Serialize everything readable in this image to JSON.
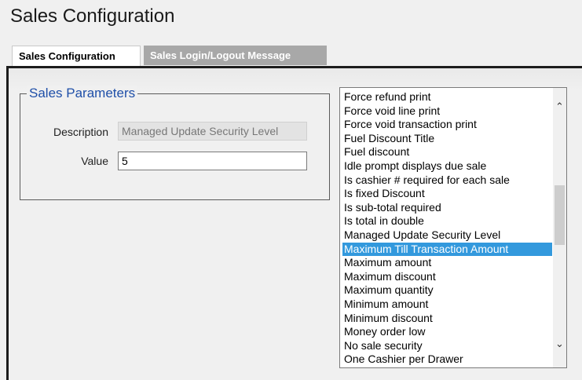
{
  "page": {
    "title": "Sales Configuration"
  },
  "tabs": [
    {
      "label": "Sales Configuration",
      "active": true
    },
    {
      "label": "Sales Login/Logout Message",
      "active": false
    }
  ],
  "sales_parameters": {
    "legend": "Sales Parameters",
    "description_label": "Description",
    "description_value": "Managed Update Security Level",
    "value_label": "Value",
    "value_value": "5"
  },
  "parameter_list": {
    "selected_index": 11,
    "items": [
      "Force refund print",
      "Force void line print",
      "Force void transaction print",
      "Fuel Discount Title",
      "Fuel discount",
      "Idle prompt displays due sale",
      "Is cashier # required for each sale",
      "Is fixed Discount",
      "Is sub-total required",
      "Is total in double",
      "Managed Update Security Level",
      "Maximum Till Transaction Amount",
      "Maximum amount",
      "Maximum discount",
      "Maximum quantity",
      "Minimum amount",
      "Minimum discount",
      "Money order low",
      "No sale security",
      "One Cashier per Drawer"
    ]
  },
  "icons": {
    "scroll_up": "chevron-up-icon",
    "scroll_down": "chevron-down-icon"
  },
  "colors": {
    "selection": "#3399dd",
    "legend_text": "#1f4fa8",
    "inactive_tab": "#a8a8a8"
  }
}
